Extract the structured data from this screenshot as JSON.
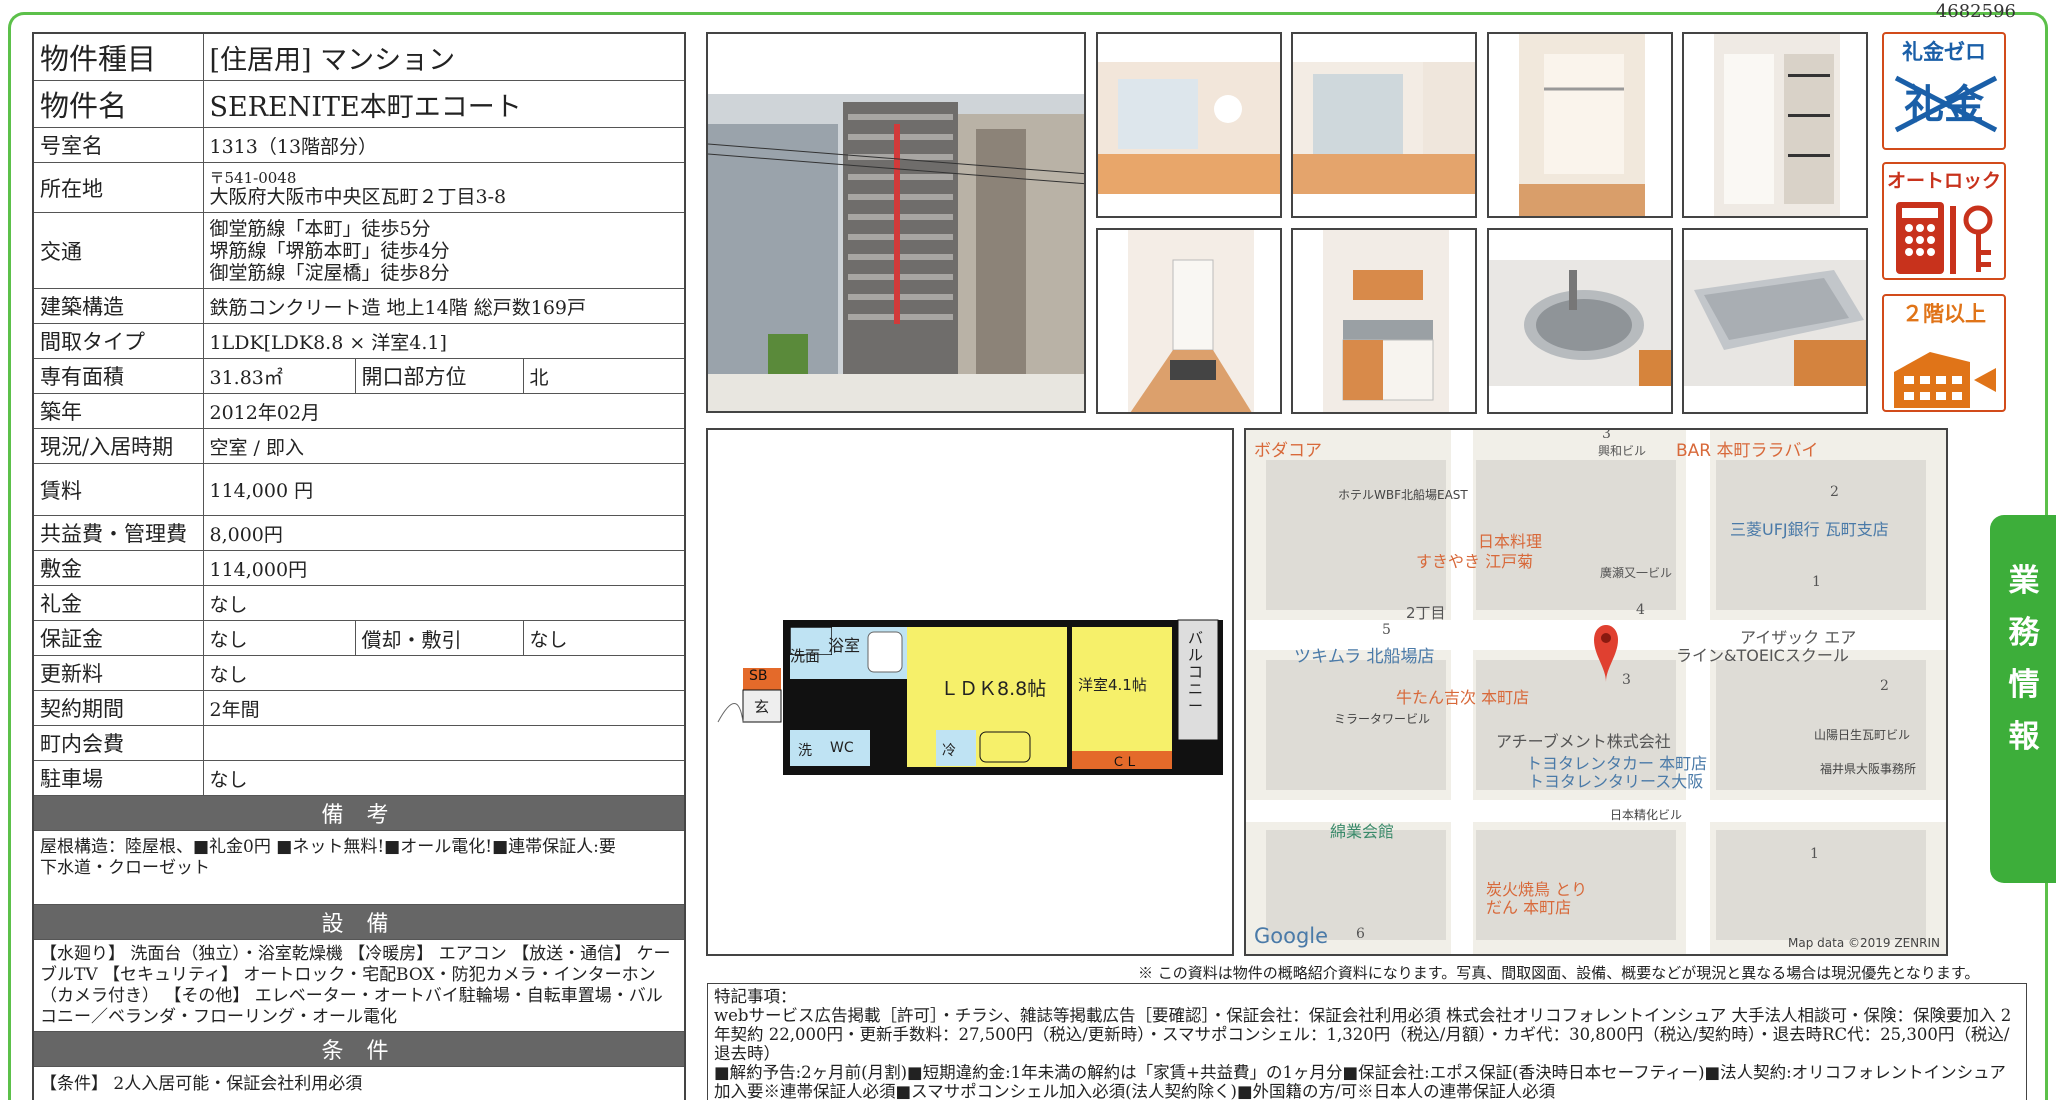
{
  "doc_id": "4682596",
  "spec": {
    "type_label": "物件種目",
    "type_value": "[住居用] マンション",
    "name_label": "物件名",
    "name_value": "SERENITE本町エコート",
    "room_label": "号室名",
    "room_value": "1313（13階部分）",
    "address_label": "所在地",
    "address_zip": "〒541-0048",
    "address_value": "大阪府大阪市中央区瓦町２丁目3-8",
    "transit_label": "交通",
    "transit_lines": [
      "御堂筋線「本町」徒歩5分",
      "堺筋線「堺筋本町」徒歩4分",
      "御堂筋線「淀屋橋」徒歩8分"
    ],
    "structure_label": "建築構造",
    "structure_value": "鉄筋コンクリート造 地上14階 総戸数169戸",
    "layout_label": "間取タイプ",
    "layout_value": "1LDK[LDK8.8 × 洋室4.1]",
    "area_label": "専有面積",
    "area_value": "31.83㎡",
    "direction_label": "開口部方位",
    "direction_value": "北",
    "built_label": "築年",
    "built_value": "2012年02月",
    "status_label": "現況/入居時期",
    "status_value": "空室 / 即入",
    "rent_label": "賃料",
    "rent_value": "114,000 円",
    "fee_label": "共益費・管理費",
    "fee_value": "8,000円",
    "deposit_label": "敷金",
    "deposit_value": "114,000円",
    "keymoney_label": "礼金",
    "keymoney_value": "なし",
    "guarantee_label": "保証金",
    "guarantee_value": "なし",
    "amort_label": "償却・敷引",
    "amort_value": "なし",
    "renewal_label": "更新料",
    "renewal_value": "なし",
    "term_label": "契約期間",
    "term_value": "2年間",
    "community_label": "町内会費",
    "community_value": "",
    "parking_label": "駐車場",
    "parking_value": "なし",
    "remarks_header": "備 考",
    "remarks_text": "屋根構造：陸屋根、■礼金0円 ■ネット無料!■オール電化!■連帯保証人:要",
    "remarks_text2": "下水道・クローゼット",
    "equipment_header": "設 備",
    "equipment_text": "【水廻り】 洗面台（独立）・浴室乾燥機 【冷暖房】 エアコン 【放送・通信】 ケーブルTV 【セキュリティ】 オートロック・宅配BOX・防犯カメラ・インターホン（カメラ付き） 【その他】 エレベーター・オートバイ駐輪場・自転車置場・バルコニー／ベランダ・フローリング・オール電化",
    "conditions_header": "条 件",
    "conditions_text": "【条件】 2人入居可能・保証会社利用必須"
  },
  "badges": {
    "no_keymoney_title": "礼金ゼロ",
    "no_keymoney_crossed": "礼金",
    "autolock_title": "オートロック",
    "second_floor_title": "２階以上"
  },
  "floorplan": {
    "bath": "浴室",
    "wash": "洗面",
    "sb": "SB",
    "entry": "玄",
    "ldk": "ＬＤＫ8.8帖",
    "western": "洋室4.1帖",
    "balcony": "バルコニー",
    "cl": "ＣＬ",
    "laundry": "洗",
    "wc": "WC",
    "fridge": "冷"
  },
  "map": {
    "labels": [
      "ボダコア",
      "興和ビル",
      "BAR 本町ララバイ",
      "ホテルWBF北船場EAST",
      "日本料理",
      "すきやき 江戸菊",
      "廣瀬又一ビル",
      "三菱UFJ銀行 瓦町支店",
      "2丁目",
      "ツキムラ 北船場店",
      "牛たん吉次 本町店",
      "アイザック エア",
      "ライン&TOEICスクール",
      "ミラータワービル",
      "アチーブメント株式会社",
      "トヨタレンタカー 本町店",
      "トヨタレンタリース大阪",
      "山陽日生瓦町ビル",
      "福井県大阪事務所",
      "綿業会館",
      "日本精化ビル",
      "炭火焼鳥 とり",
      "だん 本町店"
    ],
    "numbers": [
      "3",
      "2",
      "1",
      "5",
      "4",
      "3",
      "2",
      "1",
      "6"
    ],
    "google": "Google",
    "copyright": "Map data ©2019 ZENRIN"
  },
  "side_tab": [
    "業",
    "務",
    "情",
    "報"
  ],
  "disclaimer": "※ この資料は物件の概略紹介資料になります。写真、間取図面、設備、概要などが現況と異なる場合は現況優先となります。",
  "notes": {
    "heading": "特記事項：",
    "line1": "webサービス広告掲載［許可］・チラシ、雑誌等掲載広告［要確認］・保証会社：保証会社利用必須 株式会社オリコフォレントインシュア 大手法人相談可・保険：保険要加入 2年契約 22,000円・更新手数料：27,500円（税込/更新時）・スマサポコンシェル：1,320円（税込/月額）・カギ代：30,800円（税込/契約時）・退去時RC代：25,300円（税込/退去時）",
    "line2": "■解約予告:2ヶ月前(月割)■短期違約金:1年未満の解約は「家賃+共益費」の1ヶ月分■保証会社:エポス保証(香決時日本セーフティー)■法人契約:オリコフォレントインシュア加入要※連帯保証人必須■スマサポコンシェル加入必須(法人契約除く)■外国籍の方/可※日本人の連帯保証人必須"
  },
  "colors": {
    "frame": "#5cc04a",
    "section_bg": "#666666",
    "badge": "#d24b1a",
    "floor_yellow": "#f6f06a",
    "floor_blue": "#bfe3f3",
    "map_bg": "#f1efe8",
    "pin": "#e04030"
  }
}
